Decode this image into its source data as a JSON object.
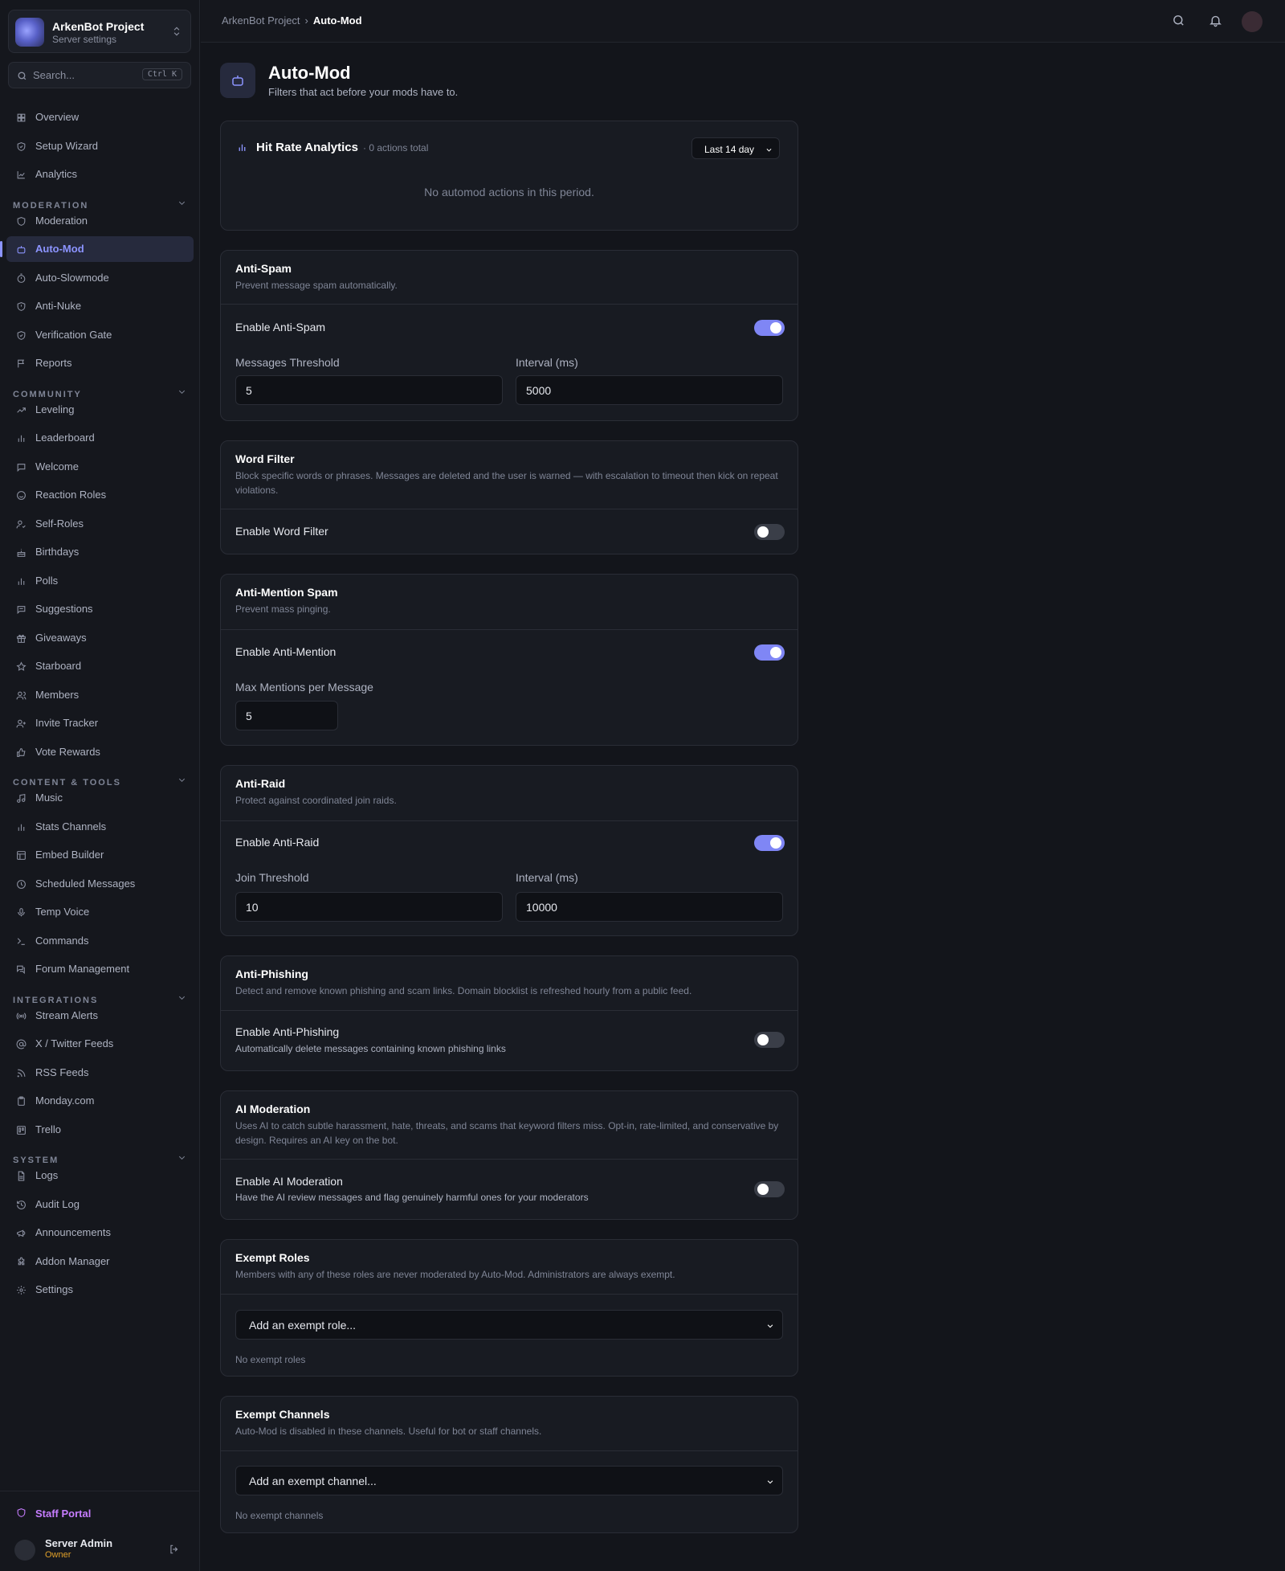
{
  "server": {
    "name": "ArkenBot Project",
    "subtitle": "Server settings"
  },
  "search": {
    "placeholder": "Search...",
    "shortcut": "Ctrl K"
  },
  "nav": {
    "top": [
      {
        "label": "Overview",
        "icon": "grid-icon"
      },
      {
        "label": "Setup Wizard",
        "icon": "shield-check-icon"
      },
      {
        "label": "Analytics",
        "icon": "line-chart-icon"
      }
    ],
    "sections": [
      {
        "title": "MODERATION",
        "items": [
          {
            "label": "Moderation",
            "icon": "shield-icon"
          },
          {
            "label": "Auto-Mod",
            "icon": "bot-icon",
            "active": true
          },
          {
            "label": "Auto-Slowmode",
            "icon": "timer-icon"
          },
          {
            "label": "Anti-Nuke",
            "icon": "shield-alert-icon"
          },
          {
            "label": "Verification Gate",
            "icon": "shield-check-icon"
          },
          {
            "label": "Reports",
            "icon": "flag-icon"
          }
        ]
      },
      {
        "title": "COMMUNITY",
        "items": [
          {
            "label": "Leveling",
            "icon": "trending-up-icon"
          },
          {
            "label": "Leaderboard",
            "icon": "bar-chart-icon"
          },
          {
            "label": "Welcome",
            "icon": "message-icon"
          },
          {
            "label": "Reaction Roles",
            "icon": "smile-icon"
          },
          {
            "label": "Self-Roles",
            "icon": "user-check-icon"
          },
          {
            "label": "Birthdays",
            "icon": "cake-icon"
          },
          {
            "label": "Polls",
            "icon": "bar-chart-icon"
          },
          {
            "label": "Suggestions",
            "icon": "message-square-icon"
          },
          {
            "label": "Giveaways",
            "icon": "gift-icon"
          },
          {
            "label": "Starboard",
            "icon": "star-icon"
          },
          {
            "label": "Members",
            "icon": "users-icon"
          },
          {
            "label": "Invite Tracker",
            "icon": "user-plus-icon"
          },
          {
            "label": "Vote Rewards",
            "icon": "thumbs-up-icon"
          }
        ]
      },
      {
        "title": "CONTENT & TOOLS",
        "items": [
          {
            "label": "Music",
            "icon": "music-icon"
          },
          {
            "label": "Stats Channels",
            "icon": "bar-chart-icon"
          },
          {
            "label": "Embed Builder",
            "icon": "layout-icon"
          },
          {
            "label": "Scheduled Messages",
            "icon": "clock-icon"
          },
          {
            "label": "Temp Voice",
            "icon": "mic-icon"
          },
          {
            "label": "Commands",
            "icon": "terminal-icon"
          },
          {
            "label": "Forum Management",
            "icon": "messages-icon"
          }
        ]
      },
      {
        "title": "INTEGRATIONS",
        "items": [
          {
            "label": "Stream Alerts",
            "icon": "radio-icon"
          },
          {
            "label": "X / Twitter Feeds",
            "icon": "at-sign-icon"
          },
          {
            "label": "RSS Feeds",
            "icon": "rss-icon"
          },
          {
            "label": "Monday.com",
            "icon": "clipboard-icon"
          },
          {
            "label": "Trello",
            "icon": "trello-icon"
          }
        ]
      },
      {
        "title": "SYSTEM",
        "items": [
          {
            "label": "Logs",
            "icon": "file-text-icon"
          },
          {
            "label": "Audit Log",
            "icon": "history-icon"
          },
          {
            "label": "Announcements",
            "icon": "megaphone-icon"
          },
          {
            "label": "Addon Manager",
            "icon": "puzzle-icon"
          },
          {
            "label": "Settings",
            "icon": "gear-icon"
          }
        ]
      }
    ]
  },
  "footer": {
    "staff": "Staff Portal",
    "user_name": "Server Admin",
    "user_role": "Owner"
  },
  "breadcrumb": {
    "parent": "ArkenBot Project",
    "current": "Auto-Mod"
  },
  "page": {
    "title": "Auto-Mod",
    "subtitle": "Filters that act before your mods have to."
  },
  "analytics": {
    "title": "Hit Rate Analytics",
    "count": "· 0 actions total",
    "range": "Last 14 day",
    "empty": "No automod actions in this period."
  },
  "anti_spam": {
    "title": "Anti-Spam",
    "desc": "Prevent message spam automatically.",
    "toggle_label": "Enable Anti-Spam",
    "enabled": true,
    "threshold_label": "Messages Threshold",
    "threshold": "5",
    "interval_label": "Interval (ms)",
    "interval": "5000"
  },
  "word_filter": {
    "title": "Word Filter",
    "desc": "Block specific words or phrases. Messages are deleted and the user is warned — with escalation to timeout then kick on repeat violations.",
    "toggle_label": "Enable Word Filter",
    "enabled": false
  },
  "anti_mention": {
    "title": "Anti-Mention Spam",
    "desc": "Prevent mass pinging.",
    "toggle_label": "Enable Anti-Mention",
    "enabled": true,
    "max_label": "Max Mentions per Message",
    "max": "5"
  },
  "anti_raid": {
    "title": "Anti-Raid",
    "desc": "Protect against coordinated join raids.",
    "toggle_label": "Enable Anti-Raid",
    "enabled": true,
    "threshold_label": "Join Threshold",
    "threshold": "10",
    "interval_label": "Interval (ms)",
    "interval": "10000"
  },
  "anti_phishing": {
    "title": "Anti-Phishing",
    "desc": "Detect and remove known phishing and scam links. Domain blocklist is refreshed hourly from a public feed.",
    "toggle_label": "Enable Anti-Phishing",
    "toggle_sub": "Automatically delete messages containing known phishing links",
    "enabled": false
  },
  "ai_moderation": {
    "title": "AI Moderation",
    "desc": "Uses AI to catch subtle harassment, hate, threats, and scams that keyword filters miss. Opt-in, rate-limited, and conservative by design. Requires an AI key on the bot.",
    "toggle_label": "Enable AI Moderation",
    "toggle_sub": "Have the AI review messages and flag genuinely harmful ones for your moderators",
    "enabled": false
  },
  "exempt_roles": {
    "title": "Exempt Roles",
    "desc": "Members with any of these roles are never moderated by Auto-Mod. Administrators are always exempt.",
    "select": "Add an exempt role...",
    "empty": "No exempt roles"
  },
  "exempt_channels": {
    "title": "Exempt Channels",
    "desc": "Auto-Mod is disabled in these channels. Useful for bot or staff channels.",
    "select": "Add an exempt channel...",
    "empty": "No exempt channels"
  },
  "colors": {
    "accent": "#8c94ff",
    "toggle_on": "#7f86f5",
    "owner": "#e0a02a",
    "staff": "#c77dff"
  }
}
